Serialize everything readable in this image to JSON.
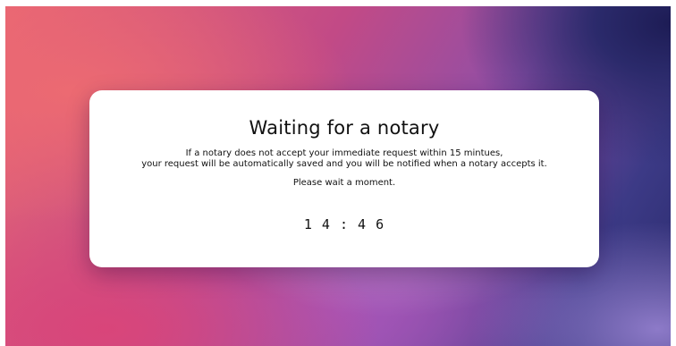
{
  "modal": {
    "title": "Waiting for a notary",
    "message_line1": "If a notary does not accept your immediate request within 15 mintues,",
    "message_line2": "your request will be automatically saved and you will be notified when a notary accepts it.",
    "wait_text": "Please wait a moment.",
    "countdown": "1 4 : 4 6"
  }
}
